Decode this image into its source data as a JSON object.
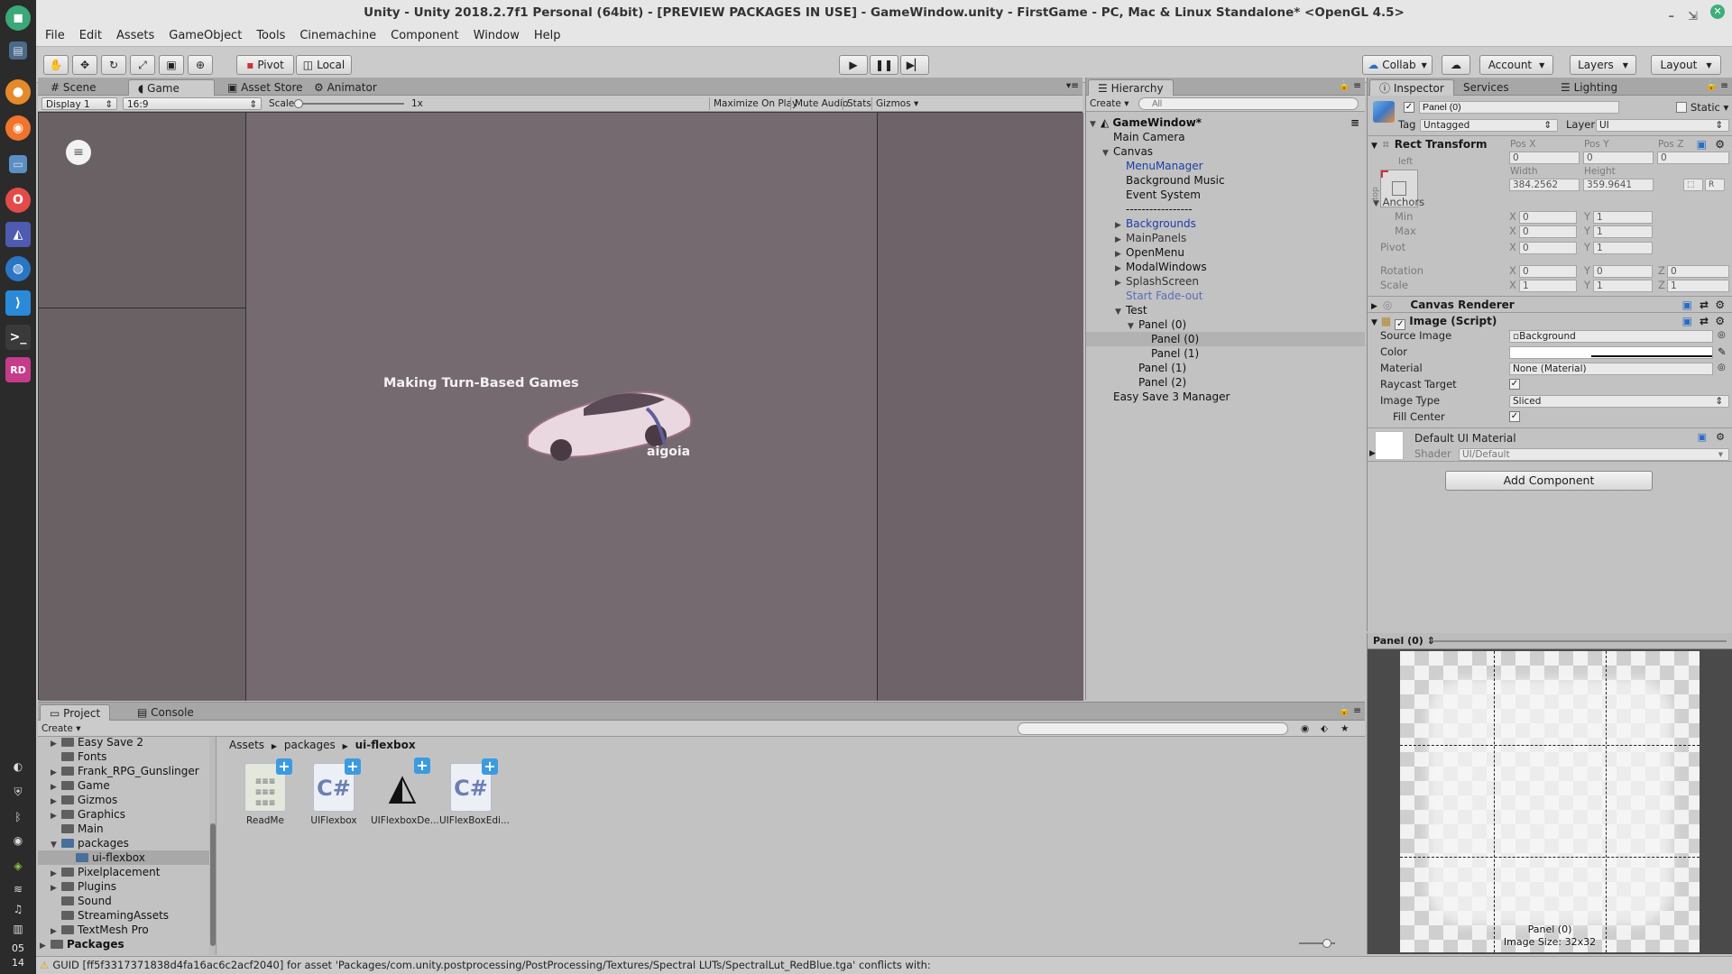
{
  "window": {
    "title": "Unity - Unity 2018.2.7f1 Personal (64bit) - [PREVIEW PACKAGES IN USE] - GameWindow.unity - FirstGame - PC, Mac & Linux Standalone* <OpenGL 4.5>"
  },
  "menu": [
    "File",
    "Edit",
    "Assets",
    "GameObject",
    "Tools",
    "Cinemachine",
    "Component",
    "Window",
    "Help"
  ],
  "toolbar": {
    "pivot": "Pivot",
    "local": "Local",
    "collab": "Collab",
    "account": "Account",
    "layers": "Layers",
    "layout": "Layout"
  },
  "scene_tabs": [
    "Scene",
    "Game",
    "Asset Store",
    "Animator"
  ],
  "game_bar": {
    "display": "Display 1",
    "aspect": "16:9",
    "scale_label": "Scale",
    "scale_value": "1x",
    "maximize": "Maximize On Play",
    "mute": "Mute Audio",
    "stats": "Stats",
    "gizmos": "Gizmos"
  },
  "game_view": {
    "headline": "Making Turn-Based Games",
    "brand": "aigoia"
  },
  "hierarchy": {
    "tab": "Hierarchy",
    "create": "Create",
    "search_placeholder": "All",
    "scene": "GameWindow*",
    "rows": [
      "Main Camera",
      "Canvas",
      "MenuManager",
      "Background Music",
      "Event System",
      "-----------------",
      "Backgrounds",
      "MainPanels",
      "OpenMenu",
      "ModalWindows",
      "SplashScreen",
      "Start Fade-out",
      "Test",
      "Panel (0)",
      "Panel (0)",
      "Panel (1)",
      "Panel (1)",
      "Panel (2)",
      "Easy Save 3 Manager"
    ]
  },
  "inspector": {
    "tabs": [
      "Inspector",
      "Services",
      "Lighting"
    ],
    "object_name": "Panel (0)",
    "static": "Static",
    "tag_label": "Tag",
    "tag_value": "Untagged",
    "layer_label": "Layer",
    "layer_value": "UI",
    "rect_transform": "Rect Transform",
    "anchor_left": "left",
    "anchor_top": "top",
    "pos_x_label": "Pos X",
    "pos_y_label": "Pos Y",
    "pos_z_label": "Pos Z",
    "pos_x": "0",
    "pos_y": "0",
    "pos_z": "0",
    "width_label": "Width",
    "height_label": "Height",
    "width": "384.2562",
    "height": "359.9641",
    "r_btn": "R",
    "anchors": "Anchors",
    "min": "Min",
    "max": "Max",
    "pivot": "Pivot",
    "min_x": "0",
    "min_y": "1",
    "max_x": "0",
    "max_y": "1",
    "pivot_x": "0",
    "pivot_y": "1",
    "rotation": "Rotation",
    "rot_x": "0",
    "rot_y": "0",
    "rot_z": "0",
    "scale": "Scale",
    "scale_x": "1",
    "scale_y": "1",
    "scale_z": "1",
    "x": "X",
    "y": "Y",
    "z": "Z",
    "canvas_renderer": "Canvas Renderer",
    "image_script": "Image (Script)",
    "source_image_label": "Source Image",
    "source_image": "Background",
    "color_label": "Color",
    "material_label": "Material",
    "material": "None (Material)",
    "raycast": "Raycast Target",
    "image_type_label": "Image Type",
    "image_type": "Sliced",
    "fill_center": "Fill Center",
    "default_material": "Default UI Material",
    "shader_label": "Shader",
    "shader": "UI/Default",
    "add_component": "Add Component",
    "preview_title": "Panel (0)",
    "preview_name": "Panel (0)",
    "preview_size": "Image Size: 32x32"
  },
  "project": {
    "tabs": [
      "Project",
      "Console"
    ],
    "create": "Create",
    "folders": [
      "Easy Save 2",
      "Fonts",
      "Frank_RPG_Gunslinger",
      "Game",
      "Gizmos",
      "Graphics",
      "Main",
      "packages",
      "ui-flexbox",
      "Pixelplacement",
      "Plugins",
      "Sound",
      "StreamingAssets",
      "TextMesh Pro",
      "Packages"
    ],
    "breadcrumb": [
      "Assets",
      "packages",
      "ui-flexbox"
    ],
    "assets": [
      "ReadMe",
      "UIFlexbox",
      "UIFlexboxDe...",
      "UIFlexBoxEdi..."
    ],
    "cs": "C#"
  },
  "status": {
    "message": "GUID [ff5f3317371838d4fa16ac6c2acf2040] for asset 'Packages/com.unity.postprocessing/PostProcessing/Textures/Spectral LUTs/SpectralLut_RedBlue.tga' conflicts with:"
  },
  "clock": {
    "hour": "05",
    "minute": "14"
  }
}
